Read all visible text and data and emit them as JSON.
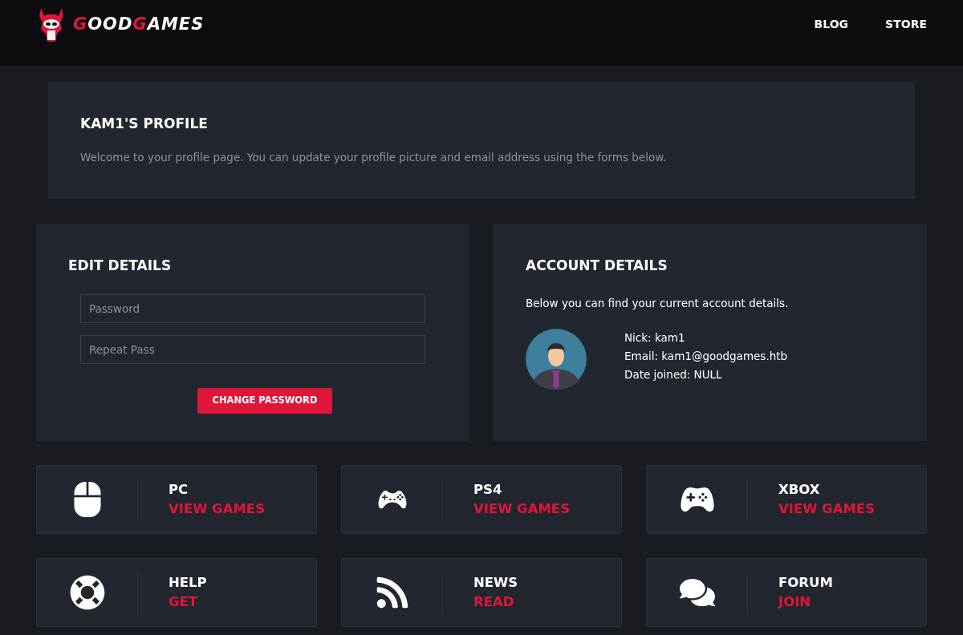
{
  "header": {
    "logo": [
      {
        "text": "G",
        "accent": true
      },
      {
        "text": "OOD",
        "accent": false
      },
      {
        "text": "G",
        "accent": true
      },
      {
        "text": "AMES",
        "accent": false
      }
    ],
    "nav": [
      "BLOG",
      "STORE"
    ]
  },
  "profile": {
    "title": "KAM1'S PROFILE",
    "text": "Welcome to your profile page. You can update your profile picture and email address using the forms below."
  },
  "edit_details": {
    "title": "EDIT DETAILS",
    "fields": [
      {
        "placeholder": "Password"
      },
      {
        "placeholder": "Repeat Pass"
      }
    ],
    "button": "CHANGE PASSWORD"
  },
  "account_details": {
    "title": "ACCOUNT DETAILS",
    "text": "Below you can find your current account details.",
    "lines": [
      "Nick: kam1",
      "Email: kam1@goodgames.htb",
      "Date joined: NULL"
    ]
  },
  "tiles": [
    {
      "kind": "mouse",
      "title": "PC",
      "link": "VIEW GAMES"
    },
    {
      "kind": "gamepad",
      "title": "PS4",
      "link": "VIEW GAMES"
    },
    {
      "kind": "controller",
      "title": "XBOX",
      "link": "VIEW GAMES"
    },
    {
      "kind": "lifebuoy",
      "title": "HELP",
      "link": "GET"
    },
    {
      "kind": "rss",
      "title": "NEWS",
      "link": "READ"
    },
    {
      "kind": "chat",
      "title": "FORUM",
      "link": "JOIN"
    }
  ]
}
